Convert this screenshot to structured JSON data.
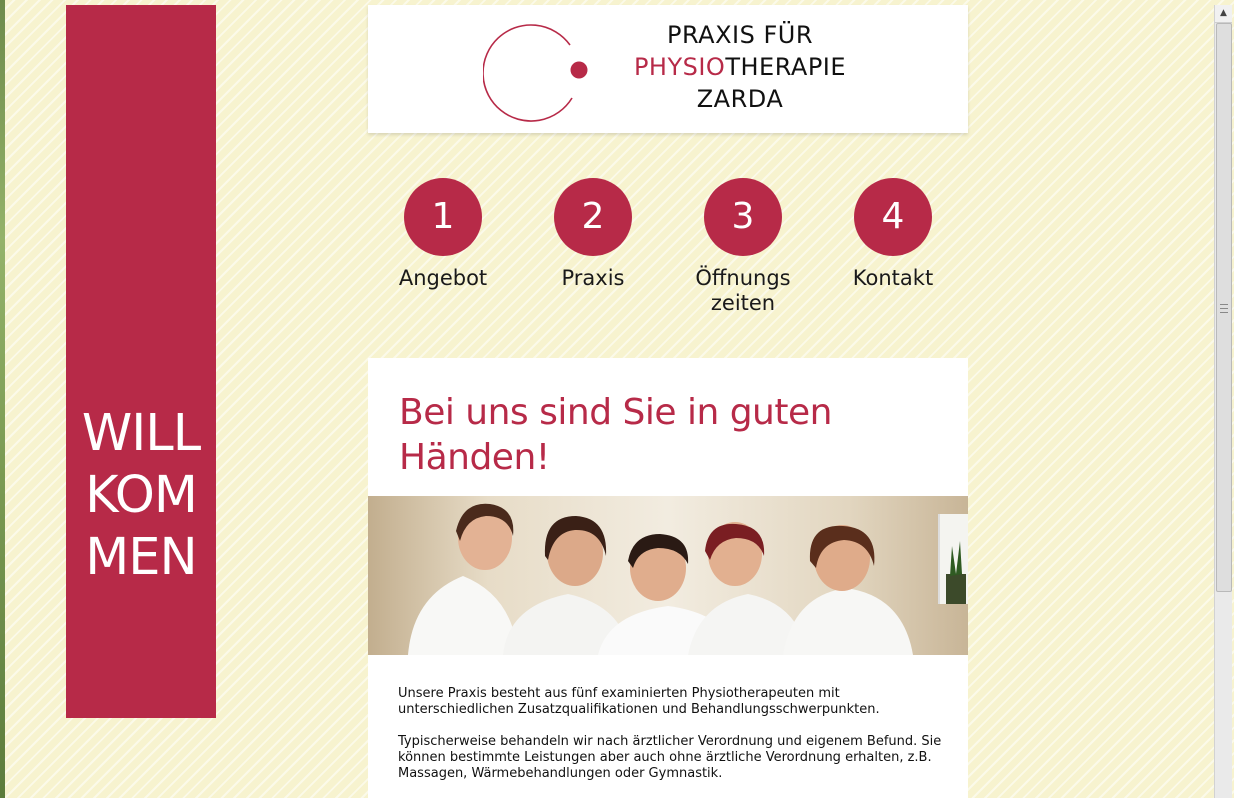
{
  "sidebar": {
    "welcome_lines": [
      "WILL",
      "KOM",
      "MEN"
    ]
  },
  "header": {
    "logo_line1": "PRAXIS FÜR",
    "logo_line2_accent": "PHYSIO",
    "logo_line2_rest": "THERAPIE",
    "logo_line3": "ZARDA"
  },
  "nav": {
    "items": [
      {
        "number": "1",
        "label_lines": [
          "Angebot"
        ]
      },
      {
        "number": "2",
        "label_lines": [
          "Praxis"
        ]
      },
      {
        "number": "3",
        "label_lines": [
          "Öffnungs",
          "zeiten"
        ]
      },
      {
        "number": "4",
        "label_lines": [
          "Kontakt"
        ]
      }
    ]
  },
  "content": {
    "headline_lines": [
      "Bei uns sind Sie in guten",
      "Händen!"
    ],
    "paragraphs": [
      "Unsere Praxis besteht aus fünf examinierten Physiotherapeuten mit unterschiedlichen Zusatzqualifikationen und Behandlungsschwerpunkten.",
      "Typischerweise behandeln wir nach ärztlicher Verordnung und eigenem Befund. Sie können bestimmte Leistungen aber auch ohne ärztliche Verordnung erhalten, z.B. Massagen, Wärmebehandlungen oder Gymnastik."
    ]
  },
  "colors": {
    "accent": "#b72a48",
    "background": "#f7f3cf"
  },
  "icons": {
    "scroll_up": "scroll-up-arrow-icon"
  }
}
